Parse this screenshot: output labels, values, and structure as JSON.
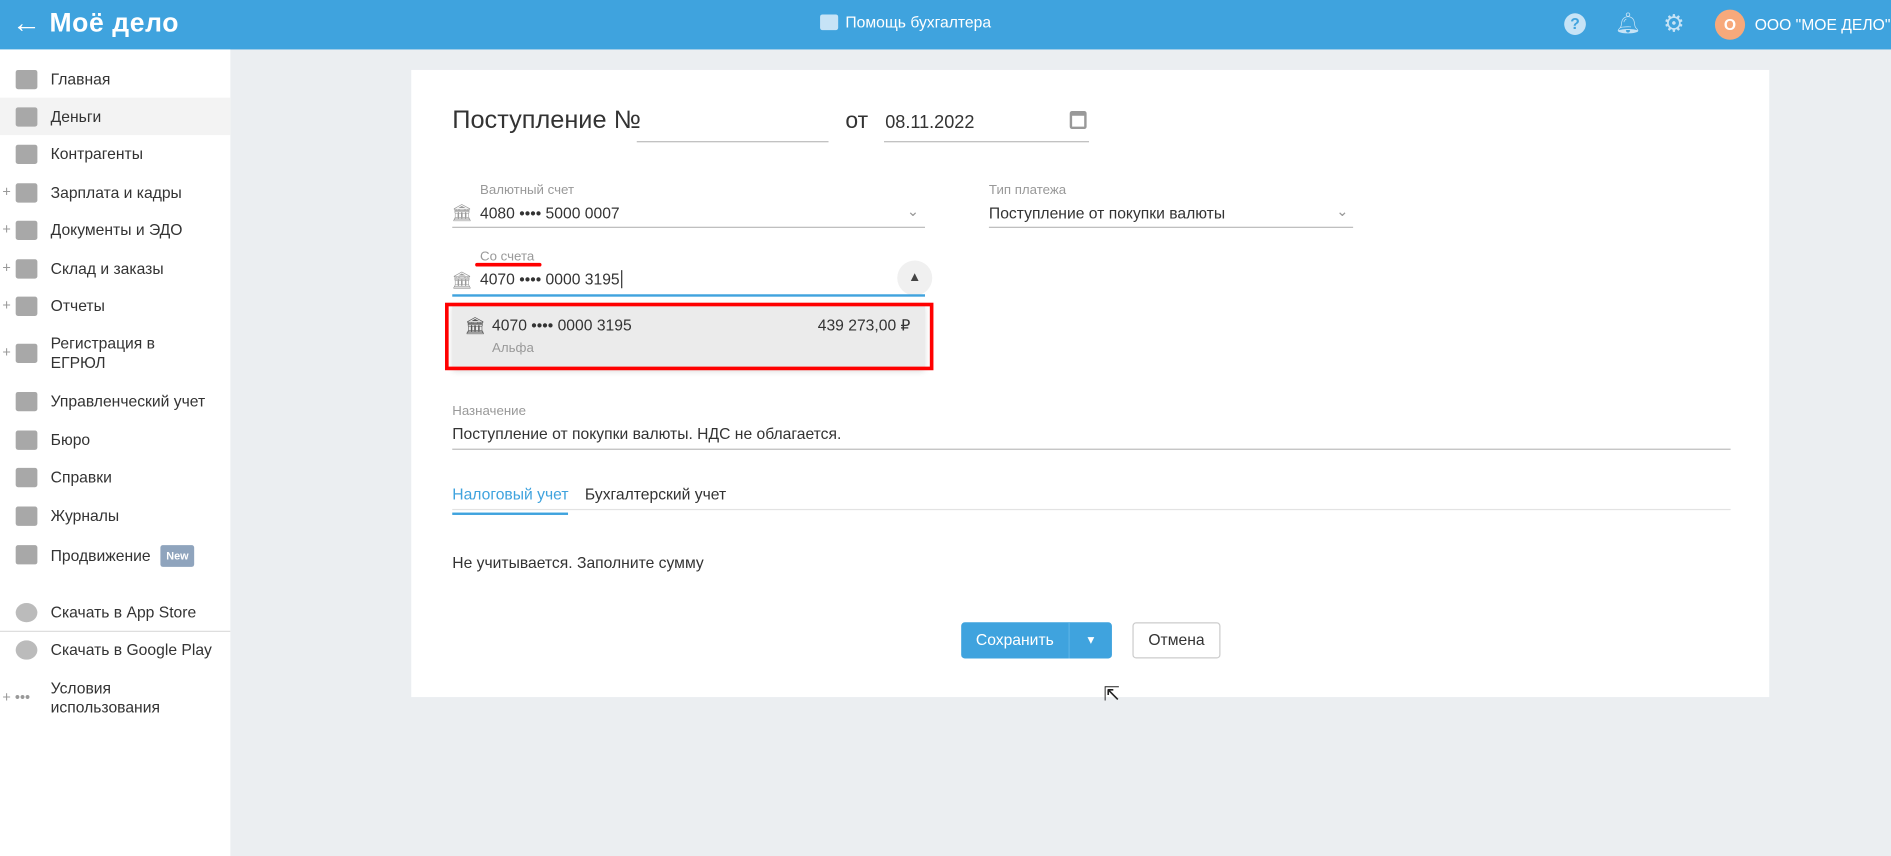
{
  "header": {
    "back_icon": "arrow-left-icon",
    "logo": "Моё дело",
    "helper": "Помощь бухгалтера",
    "avatar_letter": "О",
    "org_name": "ООО \"МОЕ ДЕЛО\""
  },
  "sidebar": {
    "items": [
      {
        "label": "Главная",
        "expandable": false
      },
      {
        "label": "Деньги",
        "expandable": false,
        "active": true
      },
      {
        "label": "Контрагенты",
        "expandable": false
      },
      {
        "label": "Зарплата и кадры",
        "expandable": true
      },
      {
        "label": "Документы и ЭДО",
        "expandable": true
      },
      {
        "label": "Склад и заказы",
        "expandable": true
      },
      {
        "label": "Отчеты",
        "expandable": true
      },
      {
        "label": "Регистрация в ЕГРЮЛ",
        "expandable": true
      },
      {
        "label": "Управленческий учет",
        "expandable": false
      },
      {
        "label": "Бюро",
        "expandable": false
      },
      {
        "label": "Справки",
        "expandable": false
      },
      {
        "label": "Журналы",
        "expandable": false
      },
      {
        "label": "Продвижение",
        "badge": "New",
        "expandable": false
      }
    ],
    "bottom": [
      {
        "label": "Скачать в App Store"
      },
      {
        "label": "Скачать в Google Play"
      },
      {
        "label": "Условия использования"
      }
    ]
  },
  "form": {
    "title": "Поступление №",
    "number": "",
    "date_prefix": "от",
    "date": "08.11.2022",
    "currency_account": {
      "label": "Валютный счет",
      "value": "4080 •••• 5000 0007"
    },
    "payment_type": {
      "label": "Тип платежа",
      "value": "Поступление от покупки валюты"
    },
    "from_account": {
      "label": "Со счета",
      "value": "4070 •••• 0000 3195"
    },
    "dropdown": [
      {
        "account": "4070 •••• 0000 3195",
        "bank": "Альфа",
        "balance": "439 273,00 ₽"
      }
    ],
    "purpose": {
      "label": "Назначение",
      "value": "Поступление от покупки валюты. НДС не облагается."
    },
    "tabs": [
      {
        "label": "Налоговый учет",
        "active": true
      },
      {
        "label": "Бухгалтерский учет",
        "active": false
      }
    ],
    "tax_note": "Не учитывается. Заполните сумму",
    "save": "Сохранить",
    "cancel": "Отмена"
  },
  "colors": {
    "brand": "#3fa3de",
    "highlight": "#ff0000"
  }
}
